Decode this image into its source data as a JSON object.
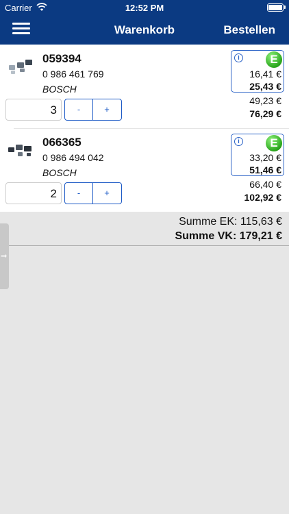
{
  "status_bar": {
    "carrier": "Carrier",
    "time": "12:52 PM"
  },
  "nav": {
    "title": "Warenkorb",
    "order_label": "Bestellen"
  },
  "cart": {
    "items": [
      {
        "article_number": "059394",
        "part_number": "0 986 461 769",
        "brand": "BOSCH",
        "quantity": "3",
        "availability_badge": "E",
        "ek_unit_price": "16,41 €",
        "vk_unit_price": "25,43 €",
        "ek_total": "49,23 €",
        "vk_total": "76,29 €"
      },
      {
        "article_number": "066365",
        "part_number": "0 986 494 042",
        "brand": "BOSCH",
        "quantity": "2",
        "availability_badge": "E",
        "ek_unit_price": "33,20 €",
        "vk_unit_price": "51,46 €",
        "ek_total": "66,40 €",
        "vk_total": "102,92 €"
      }
    ],
    "stepper": {
      "minus_label": "-",
      "plus_label": "+"
    },
    "info_icon": "i"
  },
  "summary": {
    "ek_label": "Summe EK: 115,63 €",
    "vk_label": "Summe VK: 179,21 €"
  },
  "icons": {
    "menu": "hamburger-icon",
    "wifi": "wifi-icon",
    "battery": "battery-icon",
    "info": "info-icon",
    "badge": "availability-badge",
    "drawer": "drawer-handle-icon"
  },
  "colors": {
    "header": "#0b3a82",
    "accent": "#1e5bc6",
    "badge_green": "#2aa61c",
    "background": "#e6e6e6"
  }
}
